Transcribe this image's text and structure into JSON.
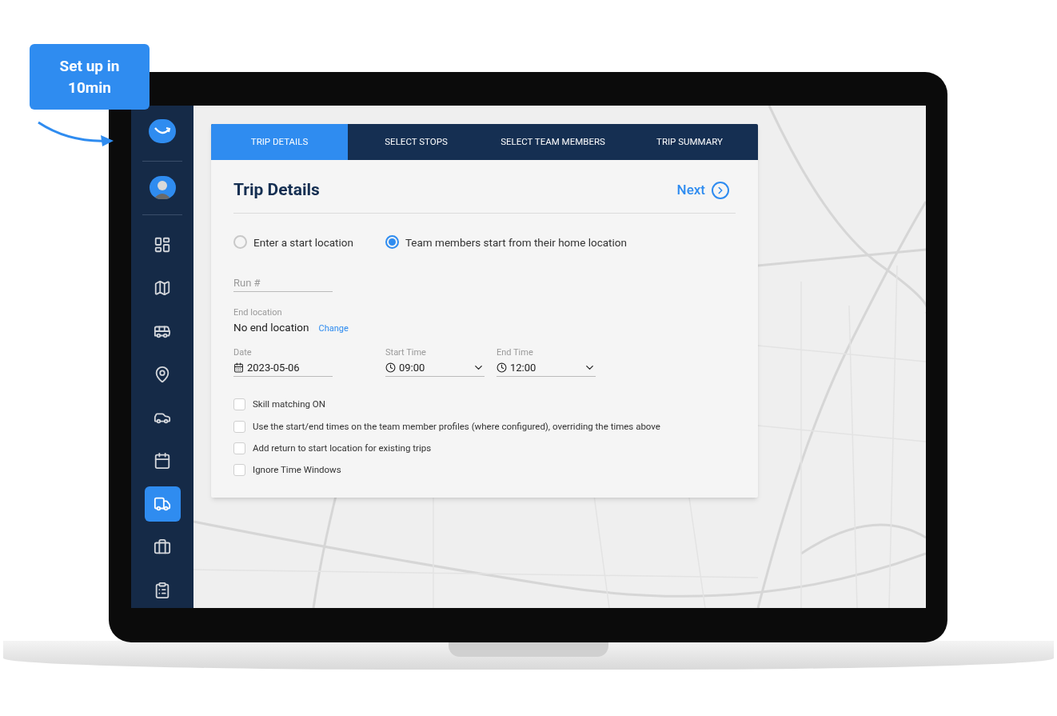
{
  "callout": {
    "text": "Set up in 10min"
  },
  "sidebar": {
    "items": [
      {
        "kind": "dashboard",
        "selected": false
      },
      {
        "kind": "map",
        "selected": false
      },
      {
        "kind": "vehicles",
        "selected": false
      },
      {
        "kind": "pin",
        "selected": false
      },
      {
        "kind": "car",
        "selected": false
      },
      {
        "kind": "calendar",
        "selected": false
      },
      {
        "kind": "truck",
        "selected": true
      },
      {
        "kind": "briefcase",
        "selected": false
      },
      {
        "kind": "clipboard",
        "selected": false
      }
    ]
  },
  "tabs": [
    {
      "label": "TRIP DETAILS",
      "selected": true
    },
    {
      "label": "SELECT STOPS",
      "selected": false
    },
    {
      "label": "SELECT TEAM MEMBERS",
      "selected": false
    },
    {
      "label": "TRIP SUMMARY",
      "selected": false
    }
  ],
  "title": "Trip Details",
  "next_button": "Next",
  "start_options": [
    {
      "label": "Enter a start location",
      "selected": false
    },
    {
      "label": "Team members start from their home location",
      "selected": true
    }
  ],
  "run_field": {
    "placeholder": "Run #"
  },
  "end_location": {
    "label": "End location",
    "value": "No end location",
    "link": "Change"
  },
  "date": {
    "label": "Date",
    "value": "2023-05-06"
  },
  "start_time": {
    "label": "Start Time",
    "value": "09:00"
  },
  "end_time": {
    "label": "End Time",
    "value": "12:00"
  },
  "options": [
    {
      "label": "Skill matching ON",
      "checked": false
    },
    {
      "label": "Use the start/end times on the team member profiles (where configured), overriding the times above",
      "checked": false
    },
    {
      "label": "Add return to start location for existing trips",
      "checked": false
    },
    {
      "label": "Ignore Time Windows",
      "checked": false
    }
  ]
}
